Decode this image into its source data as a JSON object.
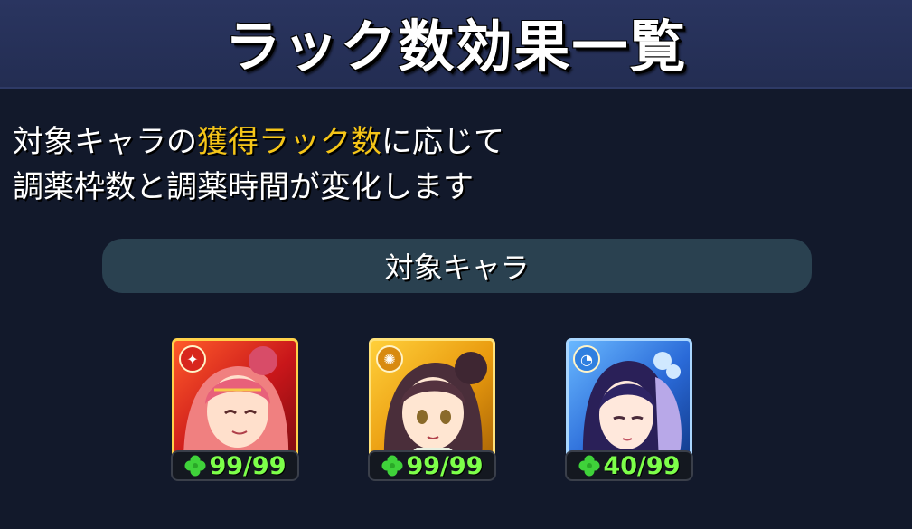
{
  "header": {
    "title": "ラック数効果一覧"
  },
  "description": {
    "line1_pre": "対象キャラの",
    "line1_highlight": "獲得ラック数",
    "line1_post": "に応じて",
    "line2": "調薬枠数と調薬時間が変化します"
  },
  "section": {
    "label": "対象キャラ"
  },
  "characters": [
    {
      "element_icon": "fire-element-icon",
      "luck": "99/99",
      "frame_color": "#c8161a"
    },
    {
      "element_icon": "light-element-icon",
      "luck": "99/99",
      "frame_color": "#e99a0e"
    },
    {
      "element_icon": "water-element-icon",
      "luck": "40/99",
      "frame_color": "#2a6ad8"
    }
  ],
  "colors": {
    "highlight": "#f5c518",
    "luck_text": "#7dff4a",
    "background": "#12192b",
    "header": "#2a3560"
  }
}
